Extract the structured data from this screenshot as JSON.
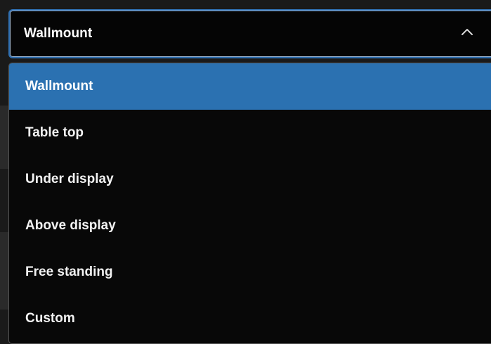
{
  "select": {
    "value": "Wallmount",
    "icon": "chevron-up-icon",
    "border_color": "#2e6eb0"
  },
  "dropdown": {
    "highlight_color": "#2b71b1",
    "options": [
      {
        "label": "Wallmount",
        "selected": true
      },
      {
        "label": "Table top",
        "selected": false
      },
      {
        "label": "Under display",
        "selected": false
      },
      {
        "label": "Above display",
        "selected": false
      },
      {
        "label": "Free standing",
        "selected": false
      },
      {
        "label": "Custom",
        "selected": false
      }
    ]
  }
}
